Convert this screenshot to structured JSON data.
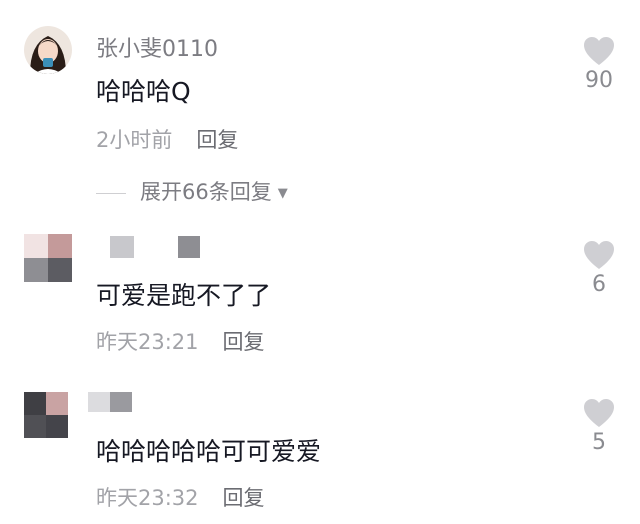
{
  "comments": [
    {
      "username": "张小斐0110",
      "content": "哈哈哈Q",
      "time": "2小时前",
      "reply_label": "回复",
      "likes": "90",
      "expand_label": "展开66条回复"
    },
    {
      "username": "",
      "content": "可爱是跑不了了",
      "time": "昨天23:21",
      "reply_label": "回复",
      "likes": "6"
    },
    {
      "username": "",
      "content": "哈哈哈哈哈可可爱爱",
      "time": "昨天23:32",
      "reply_label": "回复",
      "likes": "5"
    }
  ],
  "colors": {
    "heart": "#cfcfd3",
    "primary_text": "#161823",
    "secondary_text": "#a2a3a8"
  },
  "icons": {
    "like": "heart-icon",
    "expand": "triangle-down-icon"
  }
}
